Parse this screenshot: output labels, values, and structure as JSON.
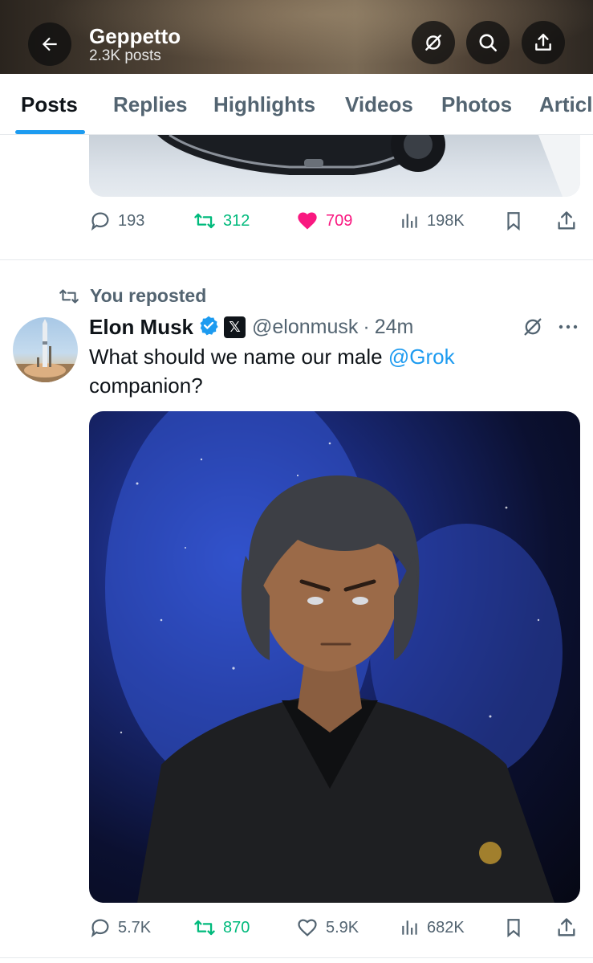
{
  "header": {
    "title": "Geppetto",
    "subtitle": "2.3K posts",
    "icons": [
      "back-arrow-icon",
      "grok-icon",
      "search-icon",
      "share-icon"
    ]
  },
  "tabs": [
    {
      "label": "Posts",
      "active": true
    },
    {
      "label": "Replies",
      "active": false
    },
    {
      "label": "Highlights",
      "active": false
    },
    {
      "label": "Videos",
      "active": false
    },
    {
      "label": "Photos",
      "active": false
    },
    {
      "label": "Articles",
      "active": false
    }
  ],
  "post1": {
    "replies": "193",
    "reposts": "312",
    "likes": "709",
    "liked": true,
    "views": "198K"
  },
  "post2": {
    "repost_label": "You reposted",
    "author": "Elon Musk",
    "x_badge": "𝕏",
    "handle": "@elonmusk",
    "separator": "·",
    "time": "24m",
    "text_before": "What should we name our male ",
    "mention": "@Grok",
    "text_after": "companion?",
    "replies": "5.7K",
    "reposts": "870",
    "likes": "5.9K",
    "views": "682K"
  },
  "colors": {
    "accent": "#1d9bf0",
    "repost_green": "#00ba7c",
    "like_pink": "#f91880",
    "secondary_text": "#536471"
  }
}
